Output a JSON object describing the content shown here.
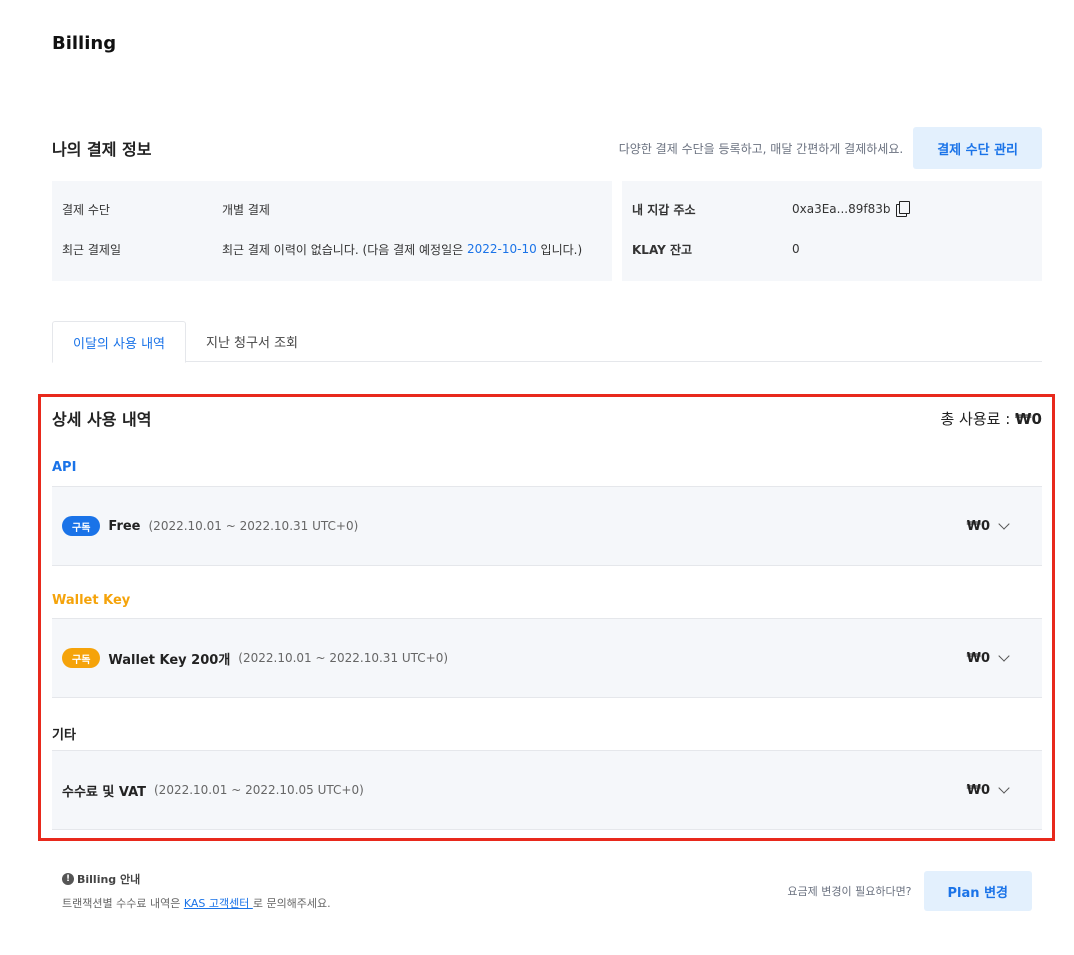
{
  "page": {
    "title": "Billing"
  },
  "payment_info": {
    "title": "나의 결제 정보",
    "hint": "다양한 결제 수단을 등록하고, 매달 간편하게 결제하세요.",
    "manage_button": "결제 수단 관리",
    "method_label": "결제 수단",
    "method_value": "개별 결제",
    "last_payment_label": "최근 결제일",
    "last_payment_prefix": "최근 결제 이력이 없습니다. (다음 결제 예정일은 ",
    "next_payment_date": "2022-10-10",
    "last_payment_suffix": " 입니다.)",
    "wallet_label": "내 지갑 주소",
    "wallet_value": "0xa3Ea...89f83b",
    "klay_label": "KLAY 잔고",
    "klay_value": "0"
  },
  "tabs": [
    {
      "label": "이달의 사용 내역",
      "active": true
    },
    {
      "label": "지난 청구서 조회",
      "active": false
    }
  ],
  "detail": {
    "title": "상세 사용 내역",
    "total_label": "총 사용료 : ",
    "total_value": "₩0",
    "categories": [
      {
        "label": "API",
        "color": "#1a73e8",
        "row": {
          "badge": "구독",
          "badge_color": "#1a73e8",
          "name": "Free",
          "period": "(2022.10.01 ~ 2022.10.31 UTC+0)",
          "amount": "₩0"
        }
      },
      {
        "label": "Wallet Key",
        "color": "#f5a30a",
        "row": {
          "badge": "구독",
          "badge_color": "#f5a30a",
          "name": "Wallet Key 200개",
          "period": "(2022.10.01 ~ 2022.10.31 UTC+0)",
          "amount": "₩0"
        }
      },
      {
        "label": "기타",
        "color": "#222222",
        "row": {
          "badge": "",
          "name": "수수료 및 VAT",
          "period": "(2022.10.01 ~ 2022.10.05 UTC+0)",
          "amount": "₩0"
        }
      }
    ]
  },
  "footer": {
    "info_title": "Billing 안내",
    "info_prefix": "트랜잭션별 수수료 내역은 ",
    "info_link": "KAS 고객센터 ",
    "info_suffix": "로 문의해주세요.",
    "plan_hint": "요금제 변경이 필요하다면?",
    "plan_button": "Plan 변경"
  }
}
